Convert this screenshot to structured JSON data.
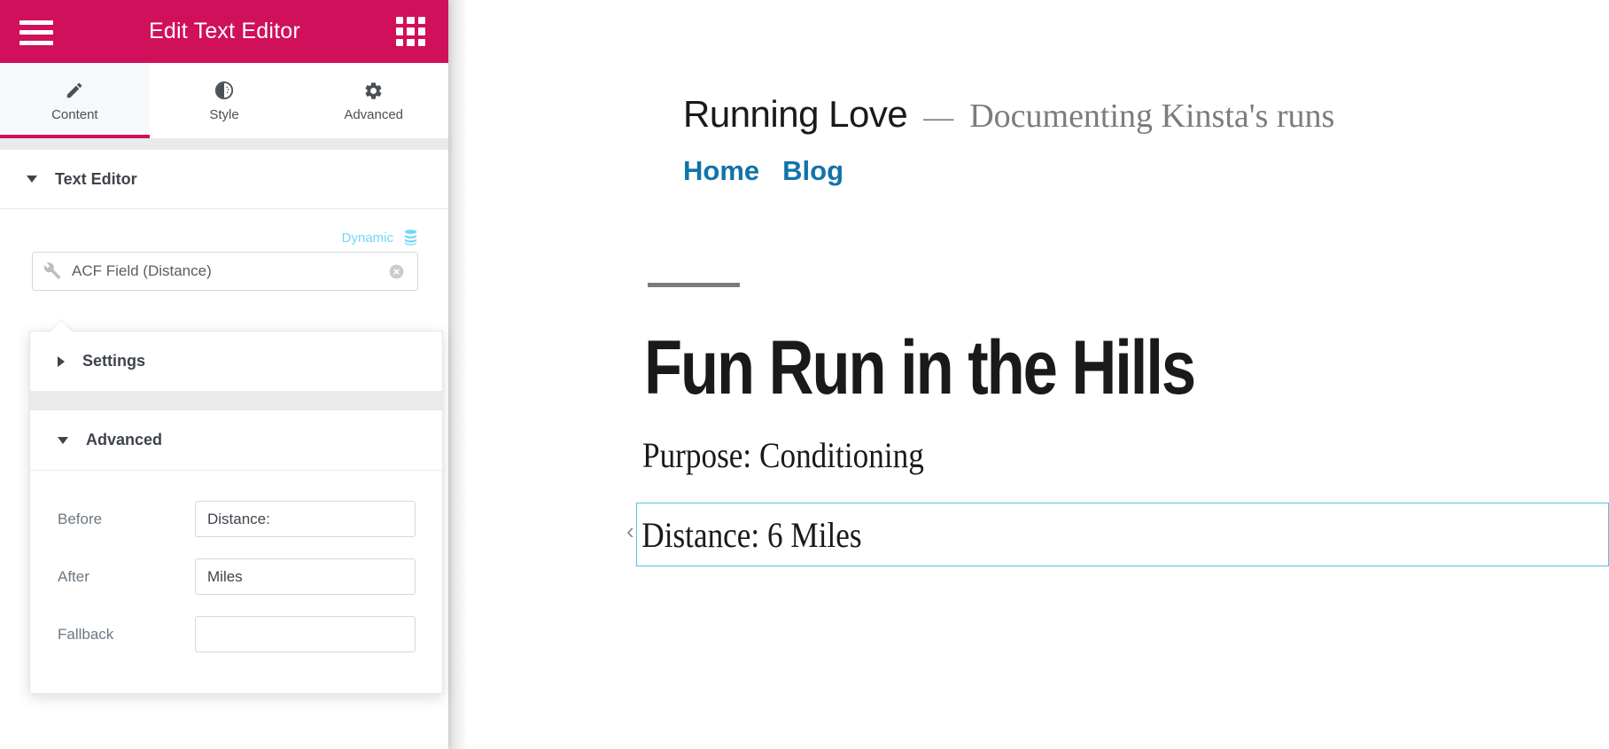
{
  "panel": {
    "header": {
      "title": "Edit Text Editor",
      "menu_icon": "hamburger-menu-icon",
      "apps_icon": "grid-apps-icon"
    },
    "tabs": [
      {
        "label": "Content",
        "icon": "pencil-icon",
        "active": true
      },
      {
        "label": "Style",
        "icon": "contrast-circle-icon",
        "active": false
      },
      {
        "label": "Advanced",
        "icon": "gear-icon",
        "active": false
      }
    ],
    "widget_section": {
      "label": "Text Editor",
      "expanded": true
    },
    "dynamic": {
      "label": "Dynamic",
      "icon": "database-stack-icon",
      "color": "#71d7f7"
    },
    "dynamic_tag": {
      "icon": "wrench-icon",
      "value": "ACF Field (Distance)",
      "clear_icon": "close-circle-icon"
    },
    "popup": {
      "settings": {
        "label": "Settings",
        "expanded": false
      },
      "advanced": {
        "label": "Advanced",
        "expanded": true
      },
      "fields": [
        {
          "label": "Before",
          "value": "Distance:",
          "placeholder": ""
        },
        {
          "label": "After",
          "value": "Miles",
          "placeholder": ""
        },
        {
          "label": "Fallback",
          "value": "",
          "placeholder": ""
        }
      ]
    },
    "accent_color": "#d0105a"
  },
  "preview": {
    "site_title": "Running Love",
    "site_dash": "—",
    "site_tagline": "Documenting Kinsta's runs",
    "nav": [
      {
        "label": "Home"
      },
      {
        "label": "Blog"
      }
    ],
    "nav_color": "#1273a8",
    "post": {
      "title": "Fun Run in the Hills",
      "meta": "Purpose: Conditioning",
      "selected_text": "Distance: 6 Miles",
      "selection_color": "#5bc0de",
      "edit_handle_icon": "chevron-left-icon"
    }
  }
}
